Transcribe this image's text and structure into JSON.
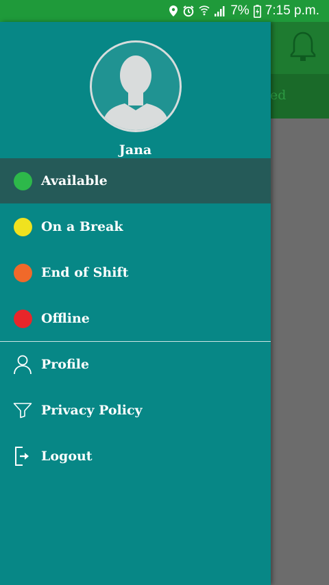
{
  "status_bar": {
    "battery_percent": "7%",
    "time": "7:15 p.m."
  },
  "background_app": {
    "tab_partial_text": "ed"
  },
  "drawer": {
    "user_name": "Jana",
    "status_items": [
      {
        "label": "Available",
        "color": "#2db84a",
        "selected": true
      },
      {
        "label": "On a Break",
        "color": "#f0e21f",
        "selected": false
      },
      {
        "label": "End of Shift",
        "color": "#f0692a",
        "selected": false
      },
      {
        "label": "Offline",
        "color": "#e8262a",
        "selected": false
      }
    ],
    "menu_items": [
      {
        "label": "Profile",
        "icon": "person-icon"
      },
      {
        "label": "Privacy Policy",
        "icon": "filter-icon"
      },
      {
        "label": "Logout",
        "icon": "logout-icon"
      }
    ]
  },
  "colors": {
    "status_bar": "#1f9a3a",
    "drawer": "#078786",
    "selected_row": "#255a58"
  }
}
